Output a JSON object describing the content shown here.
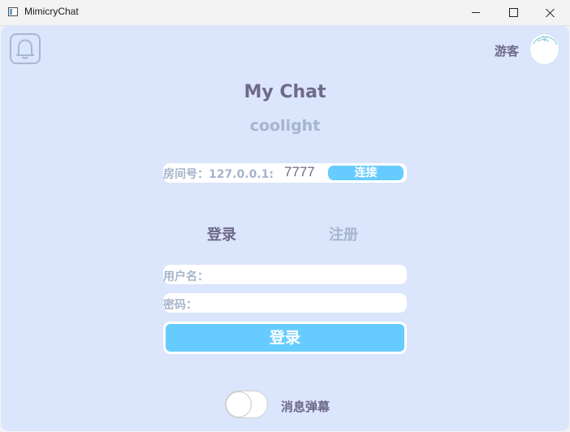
{
  "window": {
    "title": "MimicryChat",
    "icon": "app-window-icon",
    "controls": [
      "minimize-icon",
      "maximize-icon",
      "close-icon"
    ]
  },
  "header": {
    "bell_icon": "bell-icon",
    "guest_label": "游客",
    "avatar": "avatar-icon"
  },
  "app": {
    "title": "My Chat",
    "subtitle": "coolight"
  },
  "room": {
    "label": "房间号：127.0.0.1:",
    "port": "7777",
    "connect_label": "连接"
  },
  "tabs": {
    "login": "登录",
    "register": "注册"
  },
  "form": {
    "username_label": "用户名：",
    "password_label": "密码：",
    "submit_label": "登录"
  },
  "danmaku": {
    "label": "消息弹幕",
    "enabled": false
  },
  "colors": {
    "background": "#dbe5fb",
    "accent": "#66ccff",
    "text_primary": "#6e6a8a",
    "text_muted": "#a6b4cc"
  }
}
